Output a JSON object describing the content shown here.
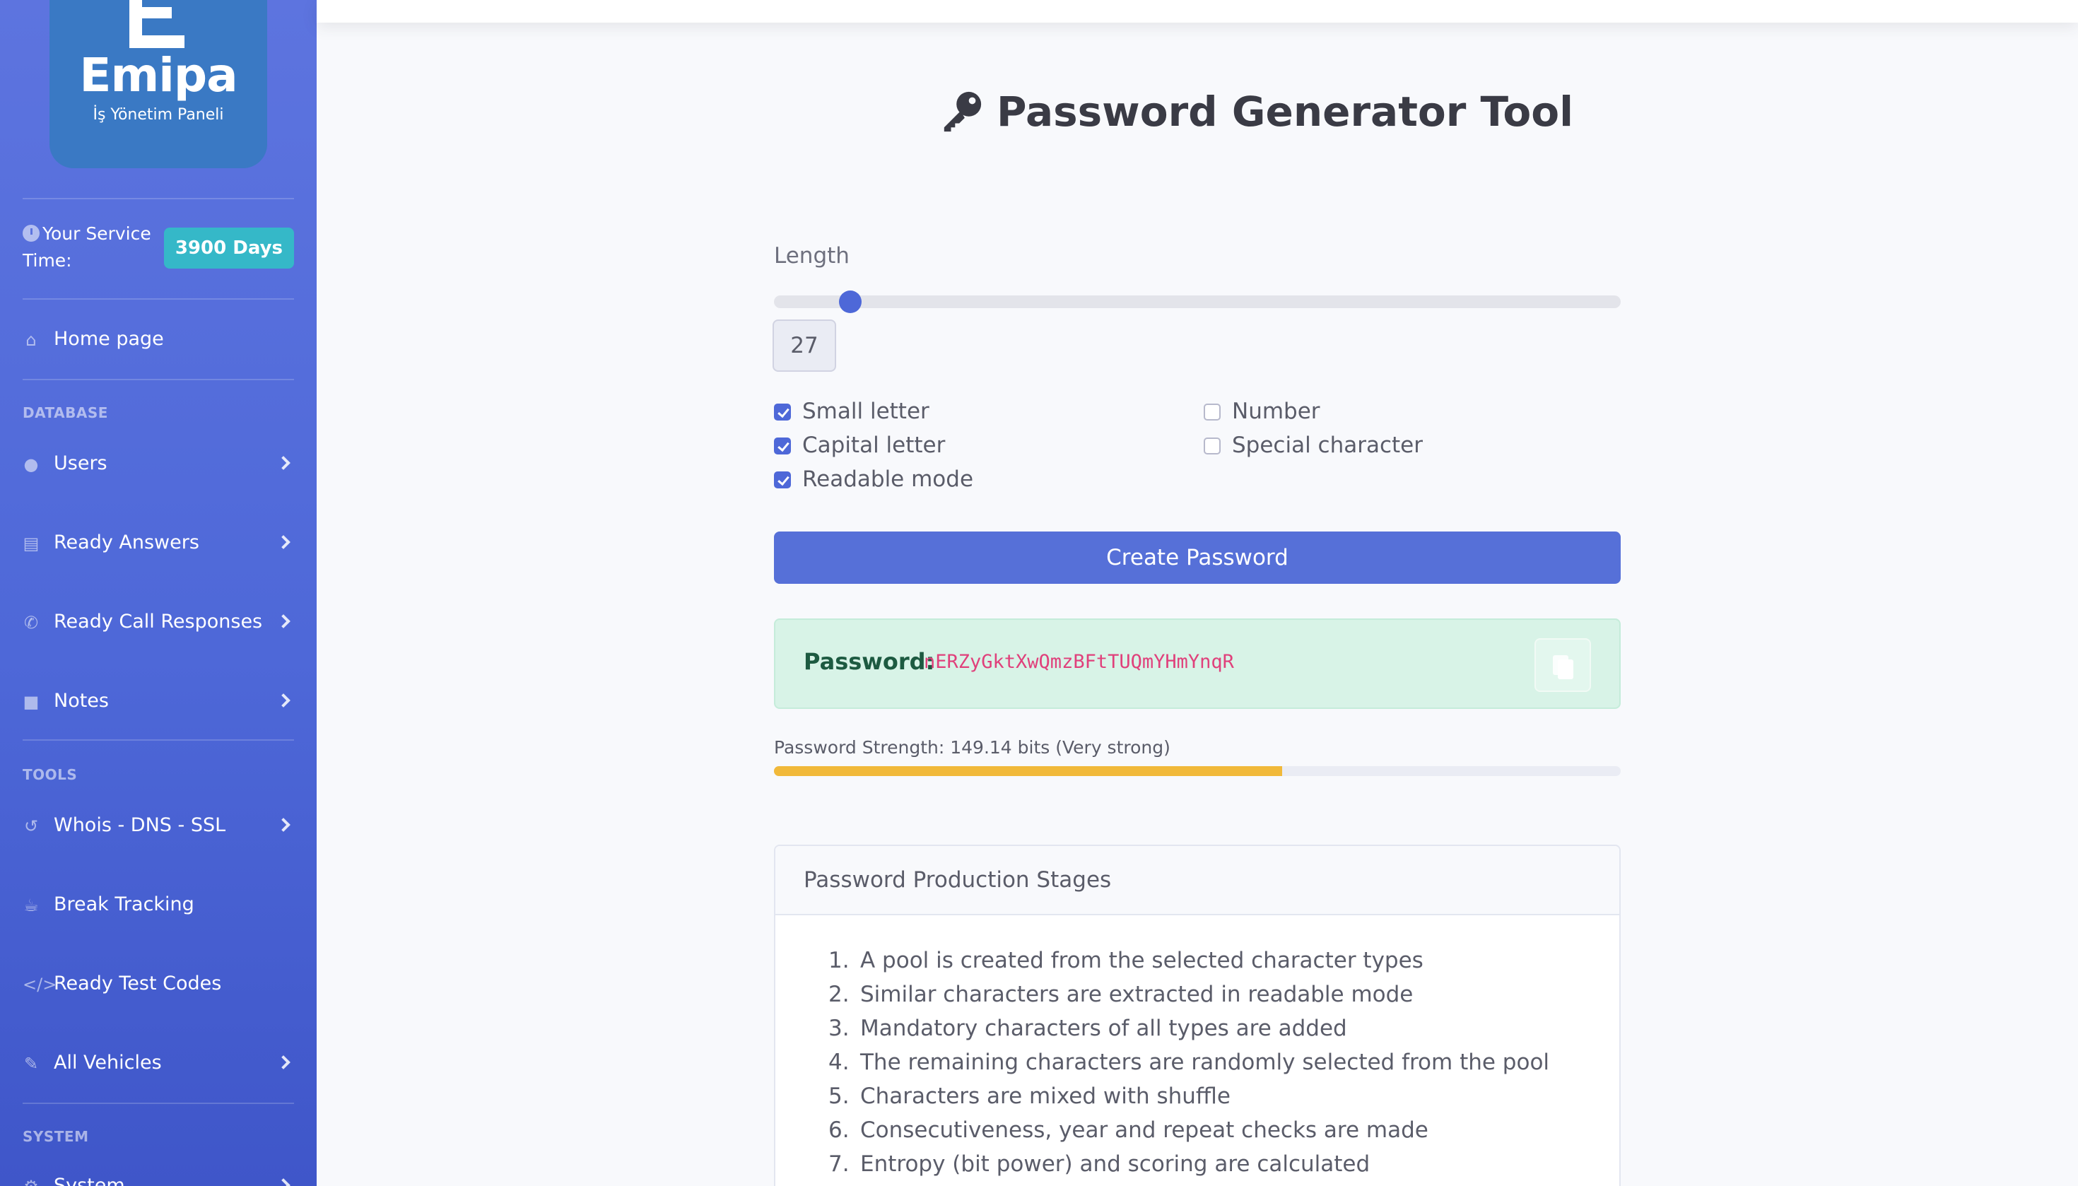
{
  "brand": {
    "name": "Emipa",
    "subtitle": "İş Yönetim Paneli"
  },
  "service": {
    "label": "Your Service Time:",
    "badge": "3900 Days"
  },
  "sidebar": {
    "home": "Home page",
    "sections": {
      "database": "DATABASE",
      "tools": "TOOLS",
      "system": "SYSTEM"
    },
    "items": [
      {
        "label": "Users",
        "icon": "user-icon"
      },
      {
        "label": "Ready Answers",
        "icon": "clipboard-icon"
      },
      {
        "label": "Ready Call Responses",
        "icon": "phone-icon"
      },
      {
        "label": "Notes",
        "icon": "sticky-note-icon"
      },
      {
        "label": "Whois - DNS - SSL",
        "icon": "history-icon"
      },
      {
        "label": "Break Tracking",
        "icon": "coffee-icon"
      },
      {
        "label": "Ready Test Codes",
        "icon": "code-icon"
      },
      {
        "label": "All Vehicles",
        "icon": "wrench-icon"
      },
      {
        "label": "System",
        "icon": "cogs-icon"
      }
    ]
  },
  "page": {
    "title": "Password Generator Tool"
  },
  "generator": {
    "length_label": "Length",
    "length_value": "27",
    "length_fraction": 0.09,
    "options": {
      "small": "Small letter",
      "capital": "Capital letter",
      "readable": "Readable mode",
      "number": "Number",
      "special": "Special character"
    },
    "checked": {
      "small": true,
      "capital": true,
      "readable": true,
      "number": false,
      "special": false
    },
    "create_label": "Create Password",
    "password_label": "Password:",
    "password_value": "nERZyGktXwQmzBFtTUQmYHmYnqR",
    "strength_text": "Password Strength: 149.14 bits (Very strong)",
    "strength_fraction": 0.6,
    "strength_color": "#f1b93a"
  },
  "stages": {
    "title": "Password Production Stages",
    "items": [
      "A pool is created from the selected character types",
      "Similar characters are extracted in readable mode",
      "Mandatory characters of all types are added",
      "The remaining characters are randomly selected from the pool",
      "Characters are mixed with shuffle",
      "Consecutiveness, year and repeat checks are made",
      "Entropy (bit power) and scoring are calculated"
    ]
  }
}
